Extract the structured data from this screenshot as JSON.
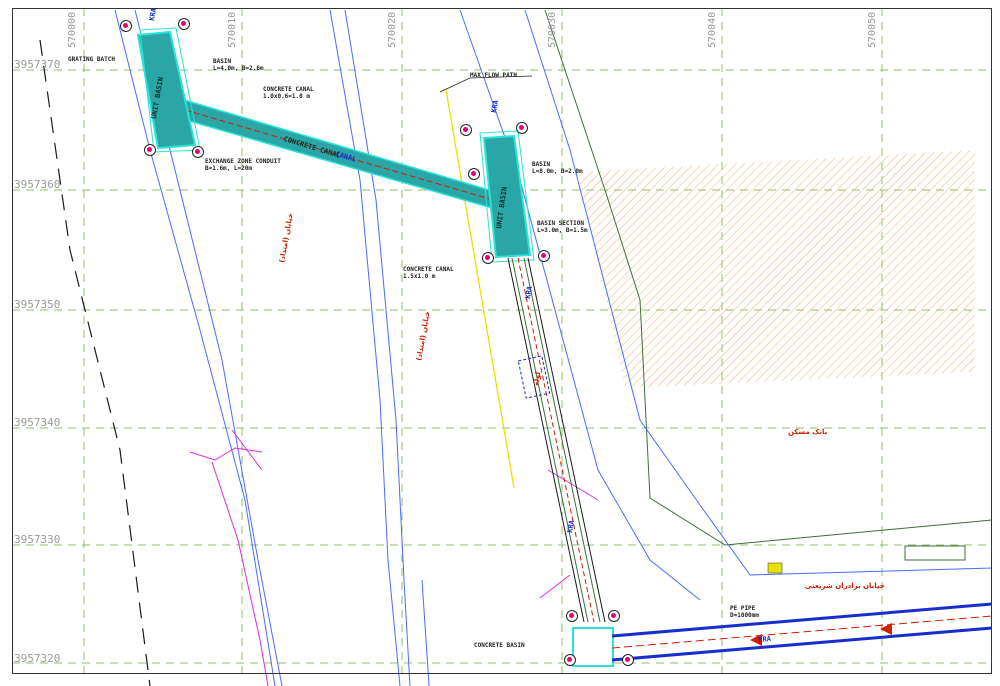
{
  "grid": {
    "northings": [
      "3957370",
      "3957360",
      "3957350",
      "3957340",
      "3957330",
      "3957320"
    ],
    "eastings": [
      "570000",
      "570010",
      "570020",
      "570030",
      "570040",
      "570050"
    ]
  },
  "notes": {
    "grating_batch": "GRATING BATCH",
    "basin_1_l1": "BASIN",
    "basin_1_l2": "L=4.0m, B=2.6m",
    "concrete_canal_1_l1": "CONCRETE CANAL",
    "concrete_canal_1_l2": "1.0x0.6=1.0 m",
    "exchange_zone_l1": "EXCHANGE ZONE CONDUIT",
    "exchange_zone_l2": "B=1.6m, L=20m",
    "max_flow_path": "MAX FLOW PATH",
    "basin_2_l1": "BASIN",
    "basin_2_l2": "L=8.0m, B=2.0m",
    "basin_section_l1": "BASIN SECTION",
    "basin_section_l2": "L=3.0m, B=1.5m",
    "concrete_canal_2_l1": "CONCRETE CANAL",
    "concrete_canal_2_l2": "1.5x1.0 m",
    "pipe_l1": "PE PIPE",
    "pipe_l2": "D=1000mm",
    "concrete_basin": "CONCRETE BASIN"
  },
  "labels_fa": {
    "road_1": "خیابان (امتداد)",
    "road_2": "خیابان (امتداد)",
    "bank": "بانک مسکن",
    "street": "خیابان برادران شریعتی",
    "pipe_text": "لوله"
  },
  "labels_blue": {
    "inlet_1": "KRA",
    "inlet_2": "KRA",
    "canal_tag_1": "CANAL",
    "canal_tag_2": "KRA",
    "canal_tag_3": "KRA",
    "pipe_tag": "KRA",
    "basin_text_1": "UNIT BASIN",
    "basin_text_2": "UNIT BASIN",
    "channel_text": "CONCRETE CANAL"
  },
  "colors": {
    "grid": "#8cbf6a",
    "cyan_fill": "#2aa6a6",
    "cyan_edge": "#27e3d8",
    "blue_line": "#1a2ccc",
    "magenta": "#e02bd9",
    "yellow": "#e6e200",
    "hatch": "#e7b27a",
    "road_green": "#3f6e3a",
    "center_red": "#d41c00"
  }
}
